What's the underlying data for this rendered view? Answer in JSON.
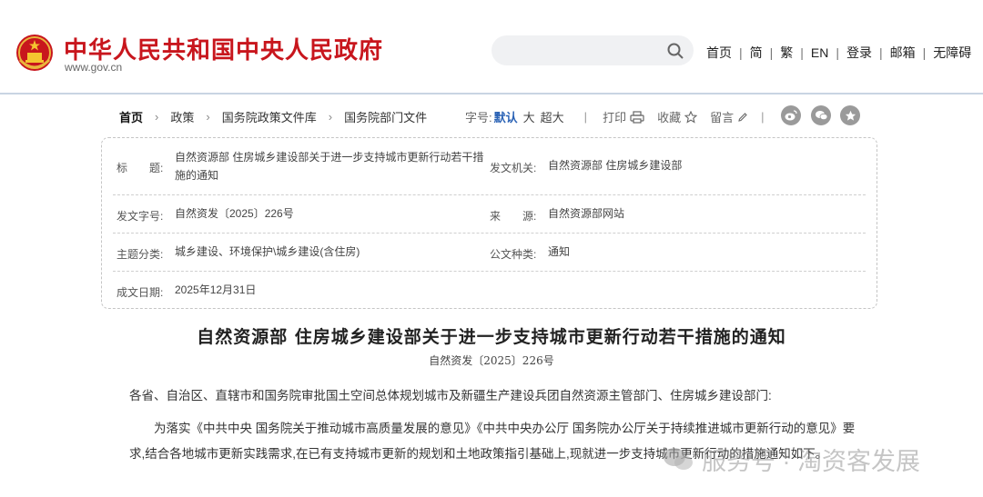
{
  "header": {
    "site_title": "中华人民共和国中央人民政府",
    "site_url": "www.gov.cn",
    "search_placeholder": "",
    "nav": [
      "首页",
      "简",
      "繁",
      "EN",
      "登录",
      "邮箱",
      "无障碍"
    ]
  },
  "breadcrumb": [
    "首页",
    "政策",
    "国务院政策文件库",
    "国务院部门文件"
  ],
  "toolbar": {
    "font_size_label": "字号:",
    "font_sizes": [
      "默认",
      "大",
      "超大"
    ],
    "print": "打印",
    "favorite": "收藏",
    "comment": "留言"
  },
  "info": {
    "title_label": "标　　题:",
    "title_value": "自然资源部 住房城乡建设部关于进一步支持城市更新行动若干措施的通知",
    "issuer_label": "发文机关:",
    "issuer_value": "自然资源部 住房城乡建设部",
    "docno_label": "发文字号:",
    "docno_value": "自然资发〔2025〕226号",
    "source_label": "来　　源:",
    "source_value": "自然资源部网站",
    "topic_label": "主题分类:",
    "topic_value": "城乡建设、环境保护\\城乡建设(含住房)",
    "type_label": "公文种类:",
    "type_value": "通知",
    "date_label": "成文日期:",
    "date_value": "2025年12月31日"
  },
  "document": {
    "title": "自然资源部 住房城乡建设部关于进一步支持城市更新行动若干措施的通知",
    "number": "自然资发〔2025〕226号",
    "salutation": "各省、自治区、直辖市和国务院审批国土空间总体规划城市及新疆生产建设兵团自然资源主管部门、住房城乡建设部门:",
    "para1": "为落实《中共中央 国务院关于推动城市高质量发展的意见》《中共中央办公厅 国务院办公厅关于持续推进城市更新行动的意见》要求,结合各地城市更新实践需求,在已有支持城市更新的规划和土地政策指引基础上,现就进一步支持城市更新行动的措施通知如下。"
  },
  "watermark": "服务号 · 淘资客发展",
  "colors": {
    "brand_red": "#c8161d",
    "accent_blue": "#2a62b5"
  }
}
